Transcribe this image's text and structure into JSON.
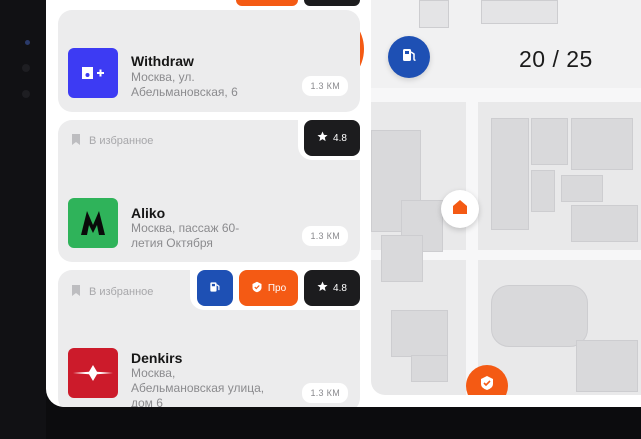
{
  "counter": "20 / 25",
  "places": [
    {
      "name": "Withdraw",
      "address": "Москва, ул. Абельмановская, 6",
      "distance": "1.3 КМ",
      "logo_color": "#3d3bf3",
      "logo_icon": "withdraw-logo-icon"
    },
    {
      "favorite_label": "В избранное",
      "rating": "4.8",
      "name": "Aliko",
      "address": "Москва, пассаж 60-летия Октября",
      "distance": "1.3 КМ",
      "logo_color": "#2fb35a",
      "logo_icon": "aliko-logo-icon"
    },
    {
      "favorite_label": "В избранное",
      "pro_label": "Про",
      "rating": "4.8",
      "name": "Denkirs",
      "address": "Москва, Абельмановская улица, дом 6",
      "distance": "1.3 КМ",
      "logo_color": "#cc1b2b",
      "logo_icon": "denkirs-logo-icon"
    }
  ],
  "colors": {
    "accent_orange": "#f45a14",
    "fuel_blue": "#1e50b4",
    "dark_badge": "#1c1c1e"
  }
}
